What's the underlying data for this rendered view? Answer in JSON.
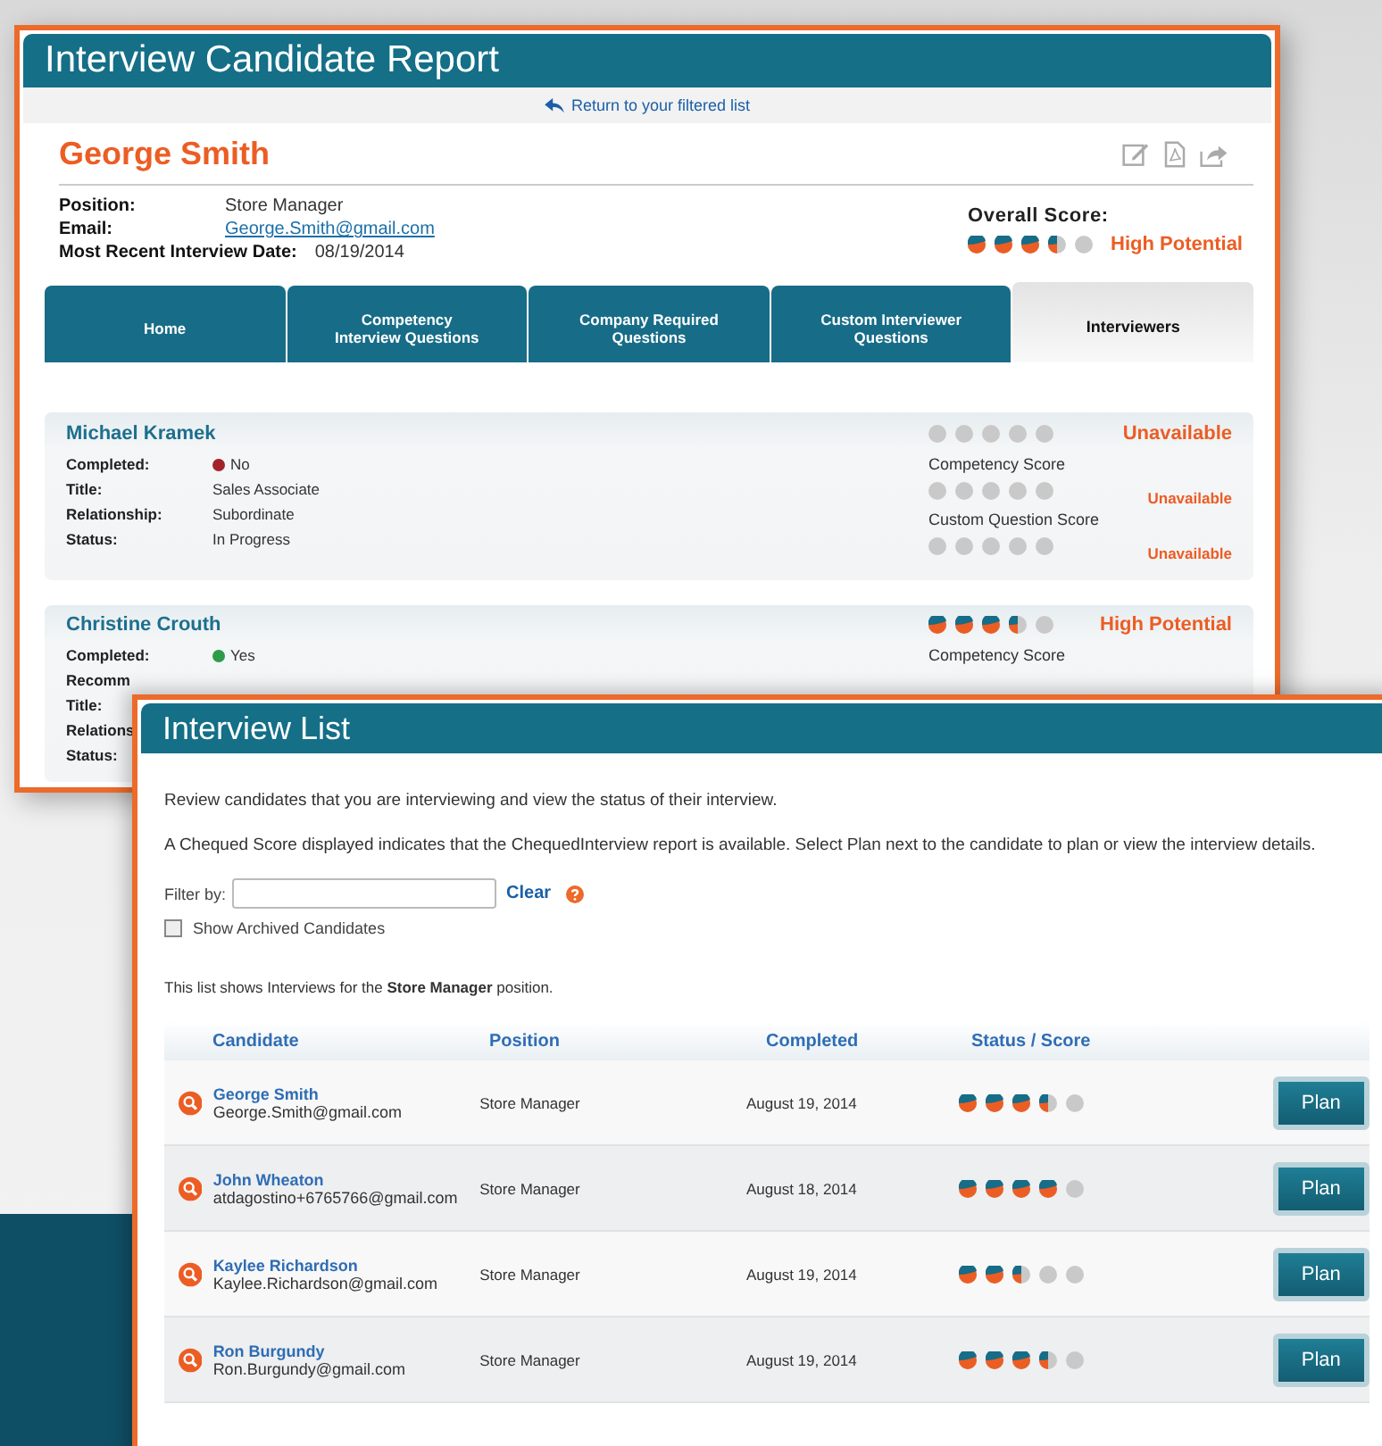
{
  "report": {
    "title": "Interview Candidate Report",
    "return_link": "Return to your filtered list",
    "candidate_name": "George Smith",
    "fields": [
      {
        "label": "Position:",
        "value": "Store Manager",
        "kind": "text"
      },
      {
        "label": "Email:",
        "value": "George.Smith@gmail.com",
        "kind": "link"
      },
      {
        "label": "Most Recent Interview Date:",
        "value": "08/19/2014",
        "kind": "text"
      }
    ],
    "overall_score": {
      "label": "Overall Score:",
      "stars": 3.5,
      "rating": "High Potential"
    },
    "tabs": [
      {
        "label": "Home",
        "selected": false
      },
      {
        "label": "Competency Interview Questions",
        "selected": false
      },
      {
        "label": "Company Required Questions",
        "selected": false
      },
      {
        "label": "Custom Interviewer Questions",
        "selected": false
      },
      {
        "label": "Interviewers",
        "selected": true
      }
    ],
    "interviewers": [
      {
        "name": "Michael Kramek",
        "stars": 0,
        "rating": "Unavailable",
        "fields": [
          {
            "label": "Completed:",
            "value": "No",
            "color": "#a3222a"
          },
          {
            "label": "Title:",
            "value": "Sales Associate"
          },
          {
            "label": "Relationship:",
            "value": "Subordinate"
          },
          {
            "label": "Status:",
            "value": "In Progress"
          }
        ],
        "scores": [
          {
            "label": "Competency Score",
            "stars": 0,
            "rating": "Unavailable"
          },
          {
            "label": "Custom Question Score",
            "stars": 0,
            "rating": "Unavailable"
          }
        ]
      },
      {
        "name": "Christine Crouth",
        "stars": 3.5,
        "rating": "High Potential",
        "fields": [
          {
            "label": "Completed:",
            "value": "Yes",
            "color": "#2e9a4a"
          },
          {
            "label": "Recomm"
          },
          {
            "label": "Title:"
          },
          {
            "label": "Relations"
          },
          {
            "label": "Status:"
          }
        ],
        "scores": [
          {
            "label": "Competency Score"
          }
        ]
      }
    ]
  },
  "list": {
    "title": "Interview List",
    "intro": [
      "Review candidates that you are interviewing and view the status of their interview.",
      "A Chequed Score displayed indicates that the ChequedInterview report is available. Select Plan next to the candidate to plan or view the interview details."
    ],
    "filter": {
      "label": "Filter by:",
      "clear": "Clear"
    },
    "archived": {
      "label": "Show Archived Candidates",
      "checked": false
    },
    "note": "This list shows Interviews for the **Store Manager** position.",
    "columns": [
      "Candidate",
      "Position",
      "Completed",
      "Status / Score"
    ],
    "rows": [
      {
        "name": "George Smith",
        "email": "George.Smith@gmail.com",
        "position": "Store Manager",
        "completed": "August 19, 2014",
        "stars": 3.5,
        "action": "Plan"
      },
      {
        "name": "John Wheaton",
        "email": "atdagostino+6765766@gmail.com",
        "position": "Store Manager",
        "completed": "August 18, 2014",
        "stars": 4,
        "action": "Plan"
      },
      {
        "name": "Kaylee Richardson",
        "email": "Kaylee.Richardson@gmail.com",
        "position": "Store Manager",
        "completed": "August 19, 2014",
        "stars": 2.5,
        "action": "Plan"
      },
      {
        "name": "Ron Burgundy",
        "email": "Ron.Burgundy@gmail.com",
        "position": "Store Manager",
        "completed": "August 19, 2014",
        "stars": 3.5,
        "action": "Plan"
      }
    ]
  }
}
